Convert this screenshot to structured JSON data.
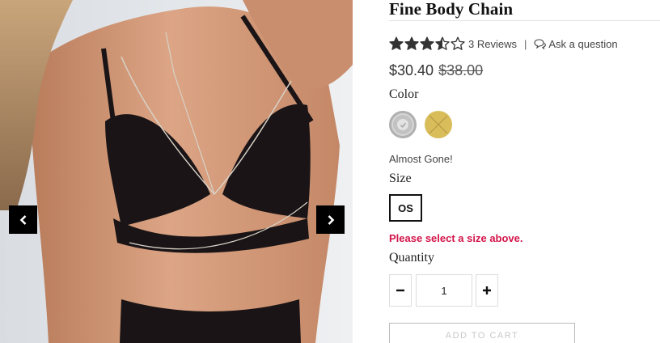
{
  "product": {
    "title": "Fine Body Chain"
  },
  "rating": {
    "stars": 3.5,
    "max_stars": 5,
    "reviews_label": "3 Reviews",
    "separator": "|",
    "ask_label": "Ask a question"
  },
  "price": {
    "current": "$30.40",
    "original": "$38.00"
  },
  "color": {
    "label": "Color",
    "swatches": [
      {
        "name": "silver",
        "hex": "#c2c2c2",
        "selected": true,
        "available": true
      },
      {
        "name": "gold",
        "hex": "#d9bd5a",
        "selected": false,
        "available": false
      }
    ]
  },
  "stock_message": "Almost Gone!",
  "size": {
    "label": "Size",
    "options": [
      "OS"
    ],
    "error": "Please select a size above."
  },
  "quantity": {
    "label": "Quantity",
    "value": "1"
  },
  "cart": {
    "button_label": "ADD TO CART"
  },
  "gallery": {
    "prev_icon": "chevron-left-icon",
    "next_icon": "chevron-right-icon"
  },
  "colors": {
    "accent_error": "#d3154a",
    "arrow_bg": "#000000",
    "star": "#333333"
  }
}
